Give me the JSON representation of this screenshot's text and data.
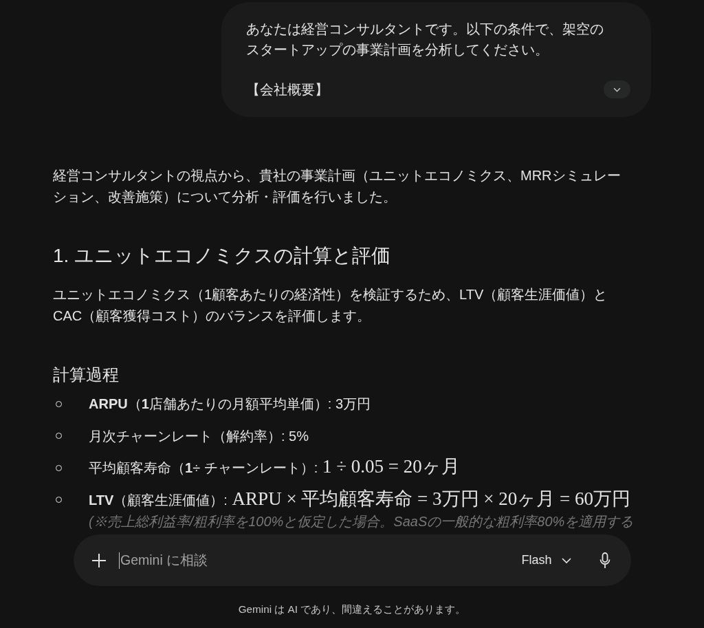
{
  "user_message": {
    "paragraphs": [
      "あなたは経営コンサルタントです。以下の条件で、架空のスタートアップの事業計画を分析してください。",
      "【会社概要】"
    ],
    "expanded": false
  },
  "response": {
    "blocks": [
      {
        "kind": "paragraph",
        "text": "経営コンサルタントの視点から、貴社の事業計画（ユニットエコノミクス、MRRシミュレーション、改善施策）について分析・評価を行いました。"
      },
      {
        "kind": "heading",
        "text": "1. ユニットエコノミクスの計算と評価"
      },
      {
        "kind": "paragraph",
        "text": "ユニットエコノミクス（1顧客あたりの経済性）を検証するため、LTV（顧客生涯価値）とCAC（顧客獲得コスト）のバランスを評価します。"
      },
      {
        "kind": "subheading",
        "text": "計算過程"
      },
      {
        "kind": "list",
        "items": [
          {
            "text": "**ARPU**（**1**店舗あたりの月額平均単価）: 3万円"
          },
          {
            "text": "月次チャーンレート（解約率）: 5%"
          },
          {
            "text": "平均顧客寿命（**1**÷ チャーンレート）:",
            "formula": "1 ÷ 0.05 = 20ヶ月"
          },
          {
            "text": "**LTV**（顧客生涯価値）:",
            "formula": "ARPU × 平均顧客寿命 = 3万円 × 20ヶ月 = 60万円",
            "note": "(※売上総利益率/粗利率を100%と仮定した場合。SaaSの一般的な粗利率80%を適用する"
          }
        ]
      }
    ]
  },
  "composer": {
    "placeholder": "Gemini に相談",
    "model": "Flash"
  },
  "disclaimer": "Gemini は AI であり、間違えることがあります。"
}
